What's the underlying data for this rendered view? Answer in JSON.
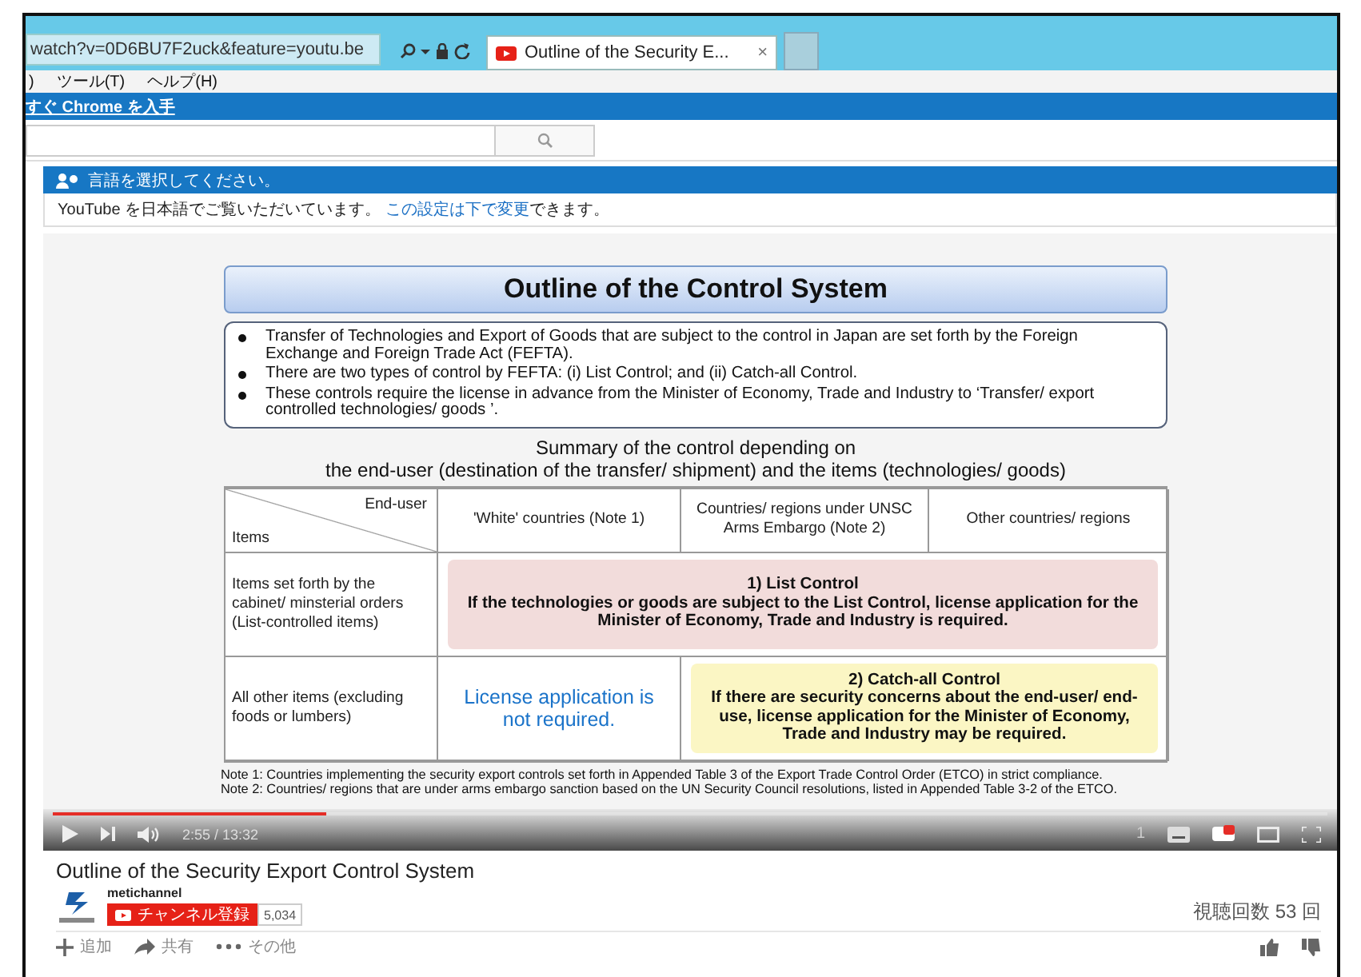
{
  "browser": {
    "address": "watch?v=0D6BU7F2uck&feature=youtu.be",
    "tab": {
      "title": "Outline of the Security E...",
      "close": "×",
      "selected": true
    },
    "menu": [
      ")",
      "ツール(T)",
      "ヘルプ(H)"
    ],
    "banner_link": "すぐ Chrome を入手"
  },
  "notice": {
    "title": "言語を選択してください。",
    "text_before": "YouTube を日本語でご覧いただいています。",
    "link": "この設定は下で変更",
    "text_after": "できます。"
  },
  "slide": {
    "title": "Outline of the Control System",
    "bullets": [
      "Transfer of Technologies and Export of Goods that are subject to the control in Japan are set forth by the Foreign Exchange and Foreign Trade Act (FEFTA).",
      "There are two types of control by FEFTA: (i) List Control; and (ii) Catch-all Control.",
      "These controls require the license in advance from the Minister of Economy, Trade and Industry to ‘Transfer/ export controlled technologies/ goods ’."
    ],
    "summary": [
      "Summary of the control depending on",
      "the end-user (destination of the transfer/ shipment) and the items (technologies/ goods)"
    ],
    "table": {
      "corner_top": "End-user",
      "corner_bottom": "Items",
      "columns": [
        "'White' countries (Note 1)",
        "Countries/ regions under UNSC Arms Embargo (Note 2)",
        "Other countries/ regions"
      ],
      "rows": [
        {
          "label": "Items set forth by the cabinet/ minsterial orders (List-controlled items)",
          "cells": [
            {
              "kind": "box",
              "color": "#f2dcdb",
              "heading": "1) List Control",
              "text": "If the technologies or goods are subject to the List Control, license application for the Minister of Economy, Trade and Industry is required."
            }
          ]
        },
        {
          "label": "All other items (excluding foods or lumbers)",
          "cells": [
            {
              "kind": "plain",
              "text": "License application is not required."
            },
            {
              "kind": "box",
              "color": "#fbf6c4",
              "heading": "2) Catch-all Control",
              "text": "If there are security concerns about the end-user/ end-use, license application for the Minister of Economy, Trade and Industry may be required."
            }
          ]
        }
      ]
    },
    "notes": [
      "Note 1: Countries implementing the security export controls set forth in Appended Table 3 of the Export Trade Control Order (ETCO) in strict compliance.",
      "Note 2: Countries/ regions that are under arms embargo sanction based on the UN Security Council resolutions, listed in Appended Table 3-2 of the ETCO."
    ]
  },
  "player": {
    "level": 0.215,
    "time": "2:55 / 13:32",
    "badge": "1"
  },
  "video": {
    "title": "Outline of the Security Export Control System",
    "channel": "metichannel",
    "subscribe": "チャンネル登録",
    "subscribers": "5,034",
    "views": "視聴回数 53 回",
    "actions": [
      "追加",
      "共有",
      "その他"
    ]
  }
}
